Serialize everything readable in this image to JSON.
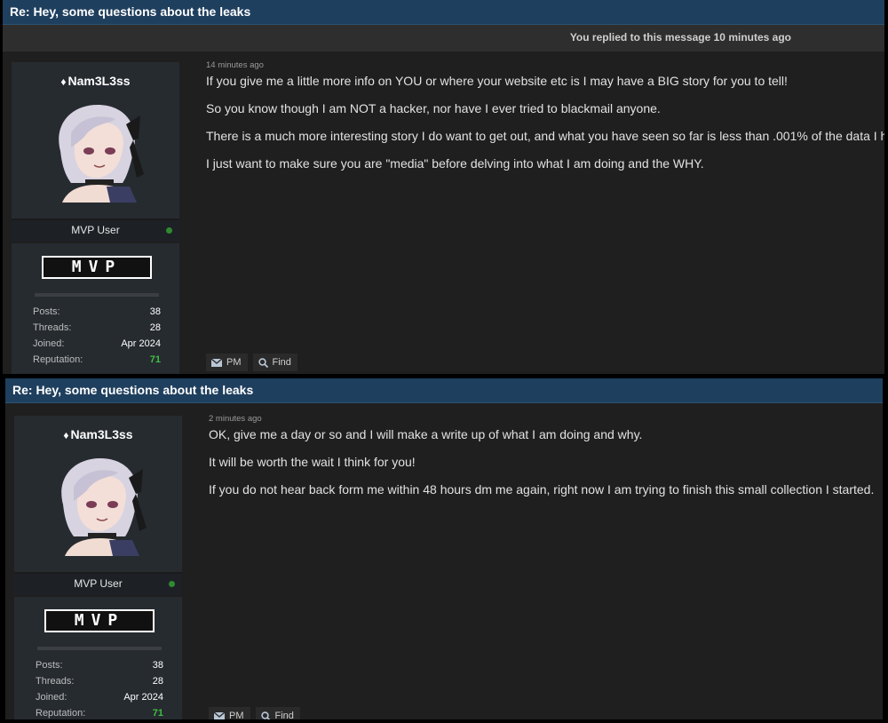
{
  "posts": [
    {
      "title": "Re: Hey, some questions about the leaks",
      "reply_notice": "You replied to this message 10 minutes ago",
      "user": {
        "name": "Nam3L3ss",
        "rank": "MVP User",
        "badge": "MVP",
        "stats": [
          {
            "label": "Posts:",
            "value": "38"
          },
          {
            "label": "Threads:",
            "value": "28"
          },
          {
            "label": "Joined:",
            "value": "Apr 2024"
          },
          {
            "label": "Reputation:",
            "value": "71"
          }
        ]
      },
      "timestamp": "14 minutes ago",
      "paragraphs": [
        "If you give me a little more info on YOU or where your website etc is I may have a BIG story for you to tell!",
        "So you know though I am NOT a hacker, nor have I ever tried to blackmail anyone.",
        "There is a much more interesting story I do want to get out, and what you have seen so far is less than .001% of the data I have.",
        "I just want to make sure you are \"media\" before delving into what I am doing and the WHY."
      ],
      "actions": {
        "pm": "PM",
        "find": "Find"
      }
    },
    {
      "title": "Re: Hey, some questions about the leaks",
      "user": {
        "name": "Nam3L3ss",
        "rank": "MVP User",
        "badge": "MVP",
        "stats": [
          {
            "label": "Posts:",
            "value": "38"
          },
          {
            "label": "Threads:",
            "value": "28"
          },
          {
            "label": "Joined:",
            "value": "Apr 2024"
          },
          {
            "label": "Reputation:",
            "value": "71"
          }
        ]
      },
      "timestamp": "2 minutes ago",
      "paragraphs": [
        "OK, give me a day or so and I will make a write up of what I am doing and why.",
        "It will be worth the wait I think for you!",
        "If you do not hear back form me within 48 hours dm me again, right now I am trying to finish this small collection I started."
      ],
      "actions": {
        "pm": "PM",
        "find": "Find"
      }
    }
  ],
  "colors": {
    "title_bar": "#1f3f5e",
    "reputation": "#3fbf3f",
    "online": "#2f8a2f"
  },
  "icons": [
    "diamond-icon",
    "envelope-icon",
    "search-icon",
    "online-status-icon"
  ]
}
